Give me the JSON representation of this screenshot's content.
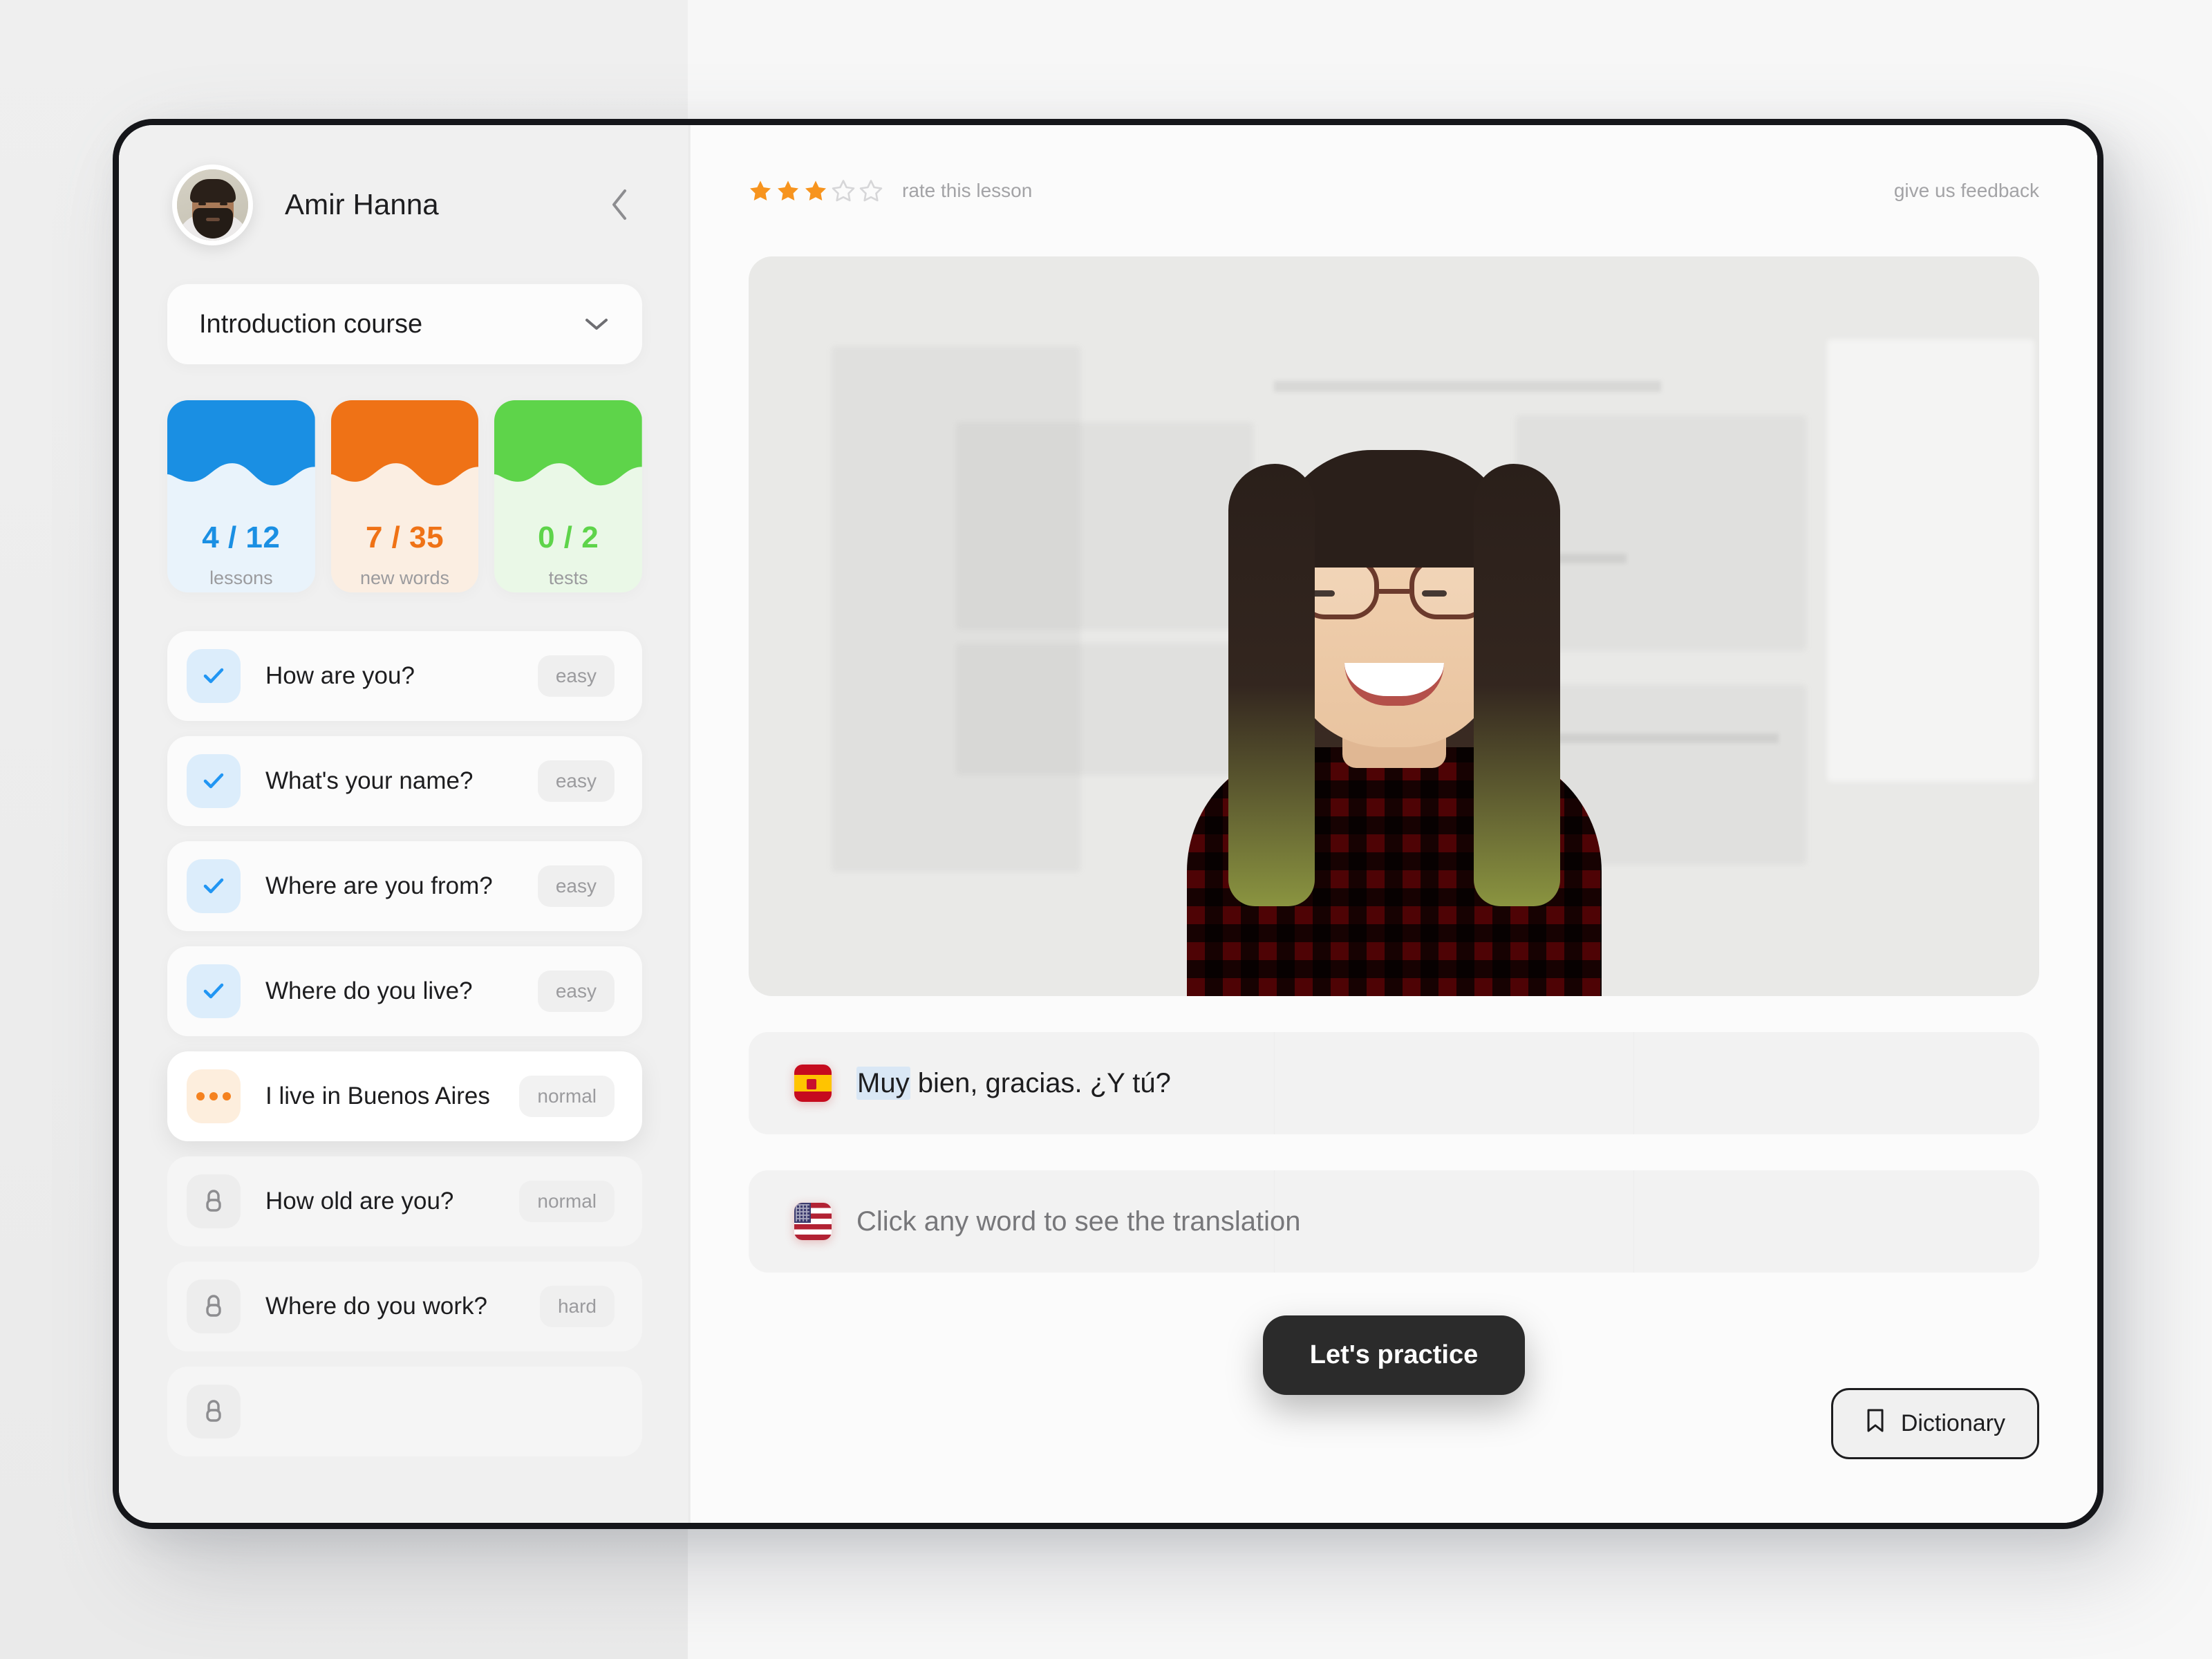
{
  "sidebar": {
    "profile": {
      "name": "Amir Hanna",
      "avatar_alt": "user-avatar"
    },
    "collapse_icon": "chevron-left-icon",
    "course": {
      "name": "Introduction course",
      "chevron_icon": "chevron-down-icon"
    },
    "stats": [
      {
        "value": "4 / 12",
        "label": "lessons",
        "color": "#1a8fe3",
        "wave": "#1a8fe3",
        "tint": "#e9f3fb"
      },
      {
        "value": "7 / 35",
        "label": "new words",
        "color": "#ef7216",
        "wave": "#ef7216",
        "tint": "#fbeee2"
      },
      {
        "value": "0 / 2",
        "label": "tests",
        "color": "#5ed44a",
        "wave": "#5ed44a",
        "tint": "#eaf8e7"
      }
    ],
    "lessons": [
      {
        "title": "How are you?",
        "badge": "easy",
        "state": "done",
        "icon": "check-icon"
      },
      {
        "title": "What's your name?",
        "badge": "easy",
        "state": "done",
        "icon": "check-icon"
      },
      {
        "title": "Where are you from?",
        "badge": "easy",
        "state": "done",
        "icon": "check-icon"
      },
      {
        "title": "Where do you live?",
        "badge": "easy",
        "state": "done",
        "icon": "check-icon"
      },
      {
        "title": "I live in Buenos Aires",
        "badge": "normal",
        "state": "active",
        "icon": "dots-icon"
      },
      {
        "title": "How old are you?",
        "badge": "normal",
        "state": "locked",
        "icon": "lock-icon"
      },
      {
        "title": "Where do you work?",
        "badge": "hard",
        "state": "locked",
        "icon": "lock-icon"
      },
      {
        "title": "",
        "badge": "",
        "state": "locked",
        "icon": "lock-icon"
      }
    ]
  },
  "main": {
    "rating": {
      "value": 3,
      "max": 5,
      "label": "rate this lesson",
      "star_color": "#f7941e",
      "empty_color": "#d6d6d8"
    },
    "feedback_link": "give us feedback",
    "media_alt": "lesson-video-still",
    "sentences": [
      {
        "flag": "es",
        "flag_name": "flag-spain",
        "highlight": "Muy",
        "rest": " bien, gracias. ¿Y tú?",
        "is_placeholder": false
      },
      {
        "flag": "us",
        "flag_name": "flag-usa",
        "highlight": "",
        "rest": "Click any word to see the translation",
        "is_placeholder": true
      }
    ],
    "practice_button": "Let's practice",
    "dictionary_button": "Dictionary",
    "dictionary_icon": "bookmark-icon"
  }
}
